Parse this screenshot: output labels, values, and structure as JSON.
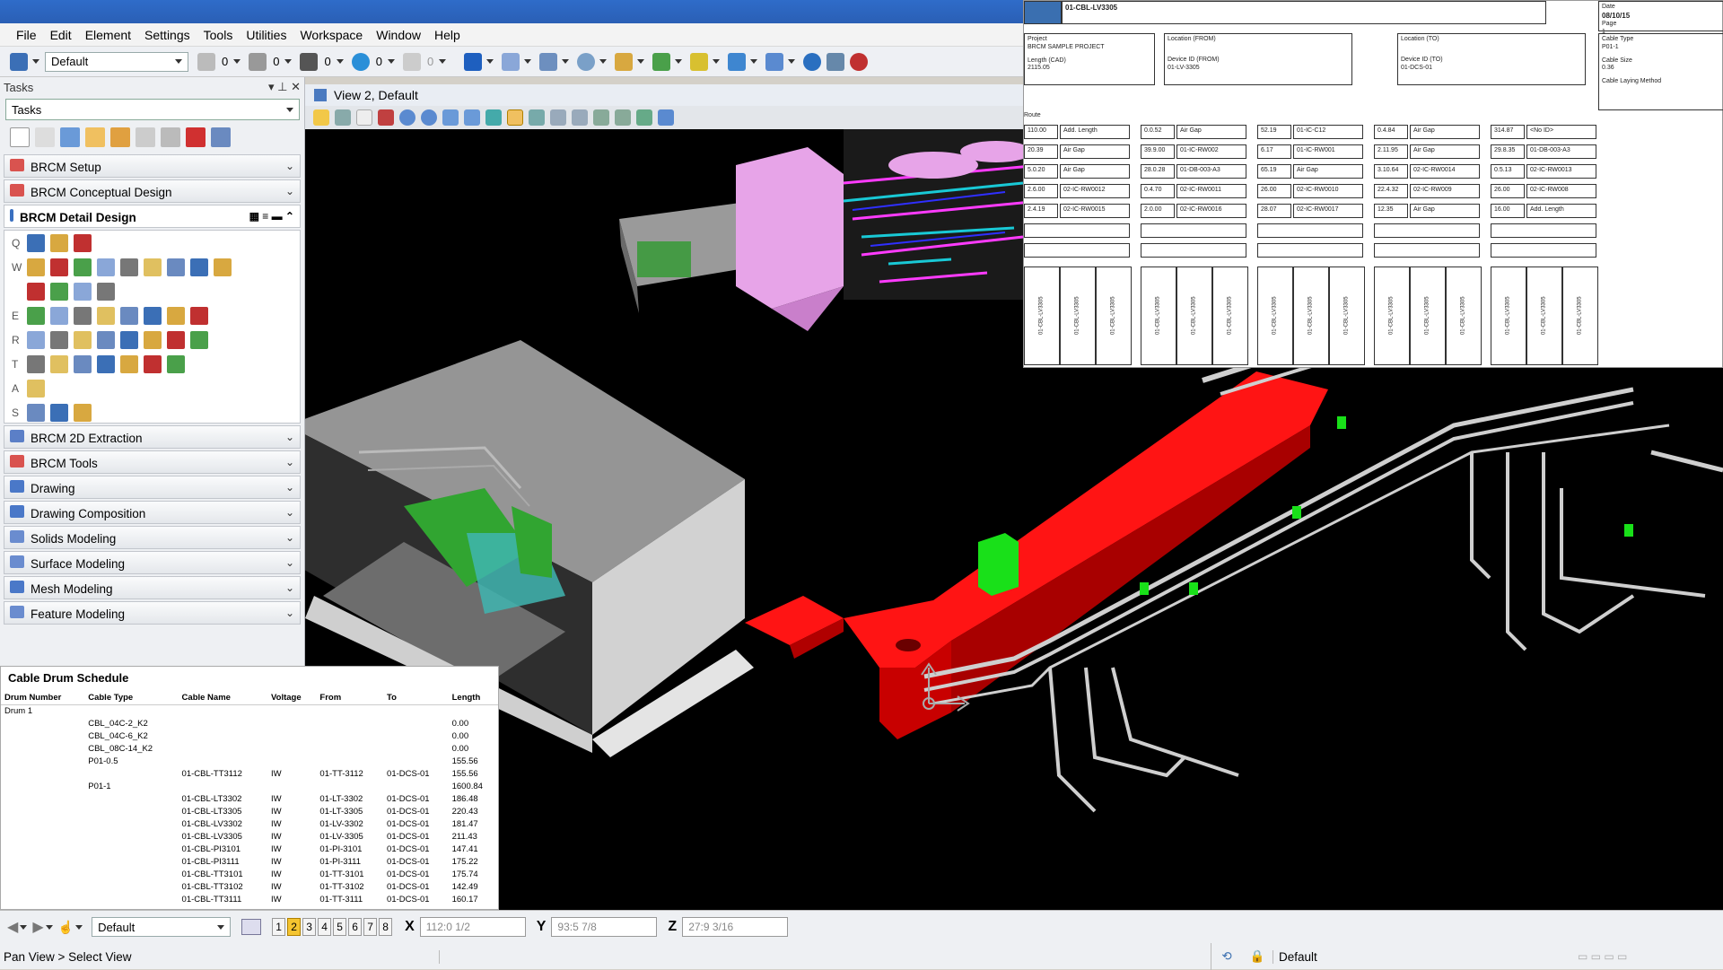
{
  "menu": [
    "File",
    "Edit",
    "Element",
    "Settings",
    "Tools",
    "Utilities",
    "Workspace",
    "Window",
    "Help"
  ],
  "toolbar": {
    "style_combo": "Default",
    "counts": [
      "0",
      "0",
      "0",
      "0",
      "0"
    ]
  },
  "tasks": {
    "header": "Tasks",
    "combo": "Tasks",
    "groups_top": [
      {
        "label": "BRCM Setup",
        "color": "#d9534f"
      },
      {
        "label": "BRCM Conceptual Design",
        "color": "#d9534f"
      }
    ],
    "detail": {
      "label": "BRCM Detail Design",
      "row_labels": [
        "Q",
        "W",
        "",
        "E",
        "R",
        "T",
        "A",
        "S"
      ]
    },
    "groups_bottom": [
      {
        "label": "BRCM 2D Extraction",
        "color": "#5b7fc7"
      },
      {
        "label": "BRCM Tools",
        "color": "#d9534f"
      },
      {
        "label": "Drawing",
        "color": "#4a78c8"
      },
      {
        "label": "Drawing Composition",
        "color": "#4a78c8"
      },
      {
        "label": "Solids Modeling",
        "color": "#6a8ccf"
      },
      {
        "label": "Surface Modeling",
        "color": "#6a8ccf"
      },
      {
        "label": "Mesh Modeling",
        "color": "#4a78c8"
      },
      {
        "label": "Feature Modeling",
        "color": "#6a8ccf"
      }
    ]
  },
  "view": {
    "title": "View 2, Default"
  },
  "report": {
    "cable_id": "01-CBL-LV3305",
    "date_label": "Date",
    "date": "08/10/15",
    "page_label": "Page",
    "page": "1",
    "project_label": "Project",
    "project": "BRCM SAMPLE PROJECT",
    "length_label": "Length (CAD)",
    "length": "2115.05",
    "loc_from_label": "Location (FROM)",
    "device_from_label": "Device ID (FROM)",
    "device_from": "01-LV-3305",
    "loc_to_label": "Location (TO)",
    "device_to_label": "Device ID (TO)",
    "device_to": "01-DCS-01",
    "cable_type_label": "Cable Type",
    "cable_type": "P01-1",
    "cable_size_label": "Cable Size",
    "cable_size": "0.36",
    "laying_label": "Cable Laying Method",
    "route_label": "Route",
    "route": [
      [
        [
          "110.00",
          "Add. Length"
        ],
        [
          "0.0.52",
          "Air Gap"
        ],
        [
          "52.19",
          "01-IC-C12"
        ],
        [
          "0.4.84",
          "Air Gap"
        ],
        [
          "314.87",
          "<No ID>"
        ]
      ],
      [
        [
          "20.39",
          "Air Gap"
        ],
        [
          "39.9.00",
          "01-IC-RW002"
        ],
        [
          "6.17",
          "01-IC-RW001"
        ],
        [
          "2.11.95",
          "Air Gap"
        ],
        [
          "29.8.35",
          "01-DB-003-A3"
        ]
      ],
      [
        [
          "5.0.20",
          "Air Gap"
        ],
        [
          "28.0.28",
          "01-DB-003-A3"
        ],
        [
          "65.19",
          "Air Gap"
        ],
        [
          "3.10.64",
          "02-IC-RW0014"
        ],
        [
          "0.5.13",
          "02-IC-RW0013"
        ]
      ],
      [
        [
          "2.6.00",
          "02-IC-RW0012"
        ],
        [
          "0.4.70",
          "02-IC-RW0011"
        ],
        [
          "26.00",
          "02-IC-RW0010"
        ],
        [
          "22.4.32",
          "02-IC-RW009"
        ],
        [
          "26.00",
          "02-IC-RW008"
        ]
      ],
      [
        [
          "2.4.19",
          "02-IC-RW0015"
        ],
        [
          "2.0.00",
          "02-IC-RW0016"
        ],
        [
          "28.07",
          "02-IC-RW0017"
        ],
        [
          "12.35",
          "Air Gap"
        ],
        [
          "16.00",
          "Add. Length"
        ]
      ]
    ],
    "label_text": "01-CBL-LV3305"
  },
  "schedule": {
    "title": "Cable Drum Schedule",
    "headers": [
      "Drum Number",
      "Cable Type",
      "Cable Name",
      "Voltage",
      "From",
      "To",
      "Length"
    ],
    "rows": [
      [
        "Drum 1",
        "",
        "",
        "",
        "",
        "",
        ""
      ],
      [
        "",
        "CBL_04C-2_K2",
        "",
        "",
        "",
        "",
        "0.00"
      ],
      [
        "",
        "CBL_04C-6_K2",
        "",
        "",
        "",
        "",
        "0.00"
      ],
      [
        "",
        "CBL_08C-14_K2",
        "",
        "",
        "",
        "",
        "0.00"
      ],
      [
        "",
        "P01-0.5",
        "",
        "",
        "",
        "",
        "155.56"
      ],
      [
        "",
        "",
        "01-CBL-TT3112",
        "IW",
        "01-TT-3112",
        "01-DCS-01",
        "155.56"
      ],
      [
        "",
        "P01-1",
        "",
        "",
        "",
        "",
        "1600.84"
      ],
      [
        "",
        "",
        "01-CBL-LT3302",
        "IW",
        "01-LT-3302",
        "01-DCS-01",
        "186.48"
      ],
      [
        "",
        "",
        "01-CBL-LT3305",
        "IW",
        "01-LT-3305",
        "01-DCS-01",
        "220.43"
      ],
      [
        "",
        "",
        "01-CBL-LV3302",
        "IW",
        "01-LV-3302",
        "01-DCS-01",
        "181.47"
      ],
      [
        "",
        "",
        "01-CBL-LV3305",
        "IW",
        "01-LV-3305",
        "01-DCS-01",
        "211.43"
      ],
      [
        "",
        "",
        "01-CBL-PI3101",
        "IW",
        "01-PI-3101",
        "01-DCS-01",
        "147.41"
      ],
      [
        "",
        "",
        "01-CBL-PI3111",
        "IW",
        "01-PI-3111",
        "01-DCS-01",
        "175.22"
      ],
      [
        "",
        "",
        "01-CBL-TT3101",
        "IW",
        "01-TT-3101",
        "01-DCS-01",
        "175.74"
      ],
      [
        "",
        "",
        "01-CBL-TT3102",
        "IW",
        "01-TT-3102",
        "01-DCS-01",
        "142.49"
      ],
      [
        "",
        "",
        "01-CBL-TT3111",
        "IW",
        "01-TT-3111",
        "01-DCS-01",
        "160.17"
      ]
    ]
  },
  "status": {
    "level_combo": "Default",
    "views": [
      "1",
      "2",
      "3",
      "4",
      "5",
      "6",
      "7",
      "8"
    ],
    "active_view": "2",
    "x_label": "X",
    "x": "112:0 1/2",
    "y_label": "Y",
    "y": "93:5 7/8",
    "z_label": "Z",
    "z": "27:9 3/16",
    "prompt": "Pan View > Select View",
    "right_combo": "Default"
  }
}
